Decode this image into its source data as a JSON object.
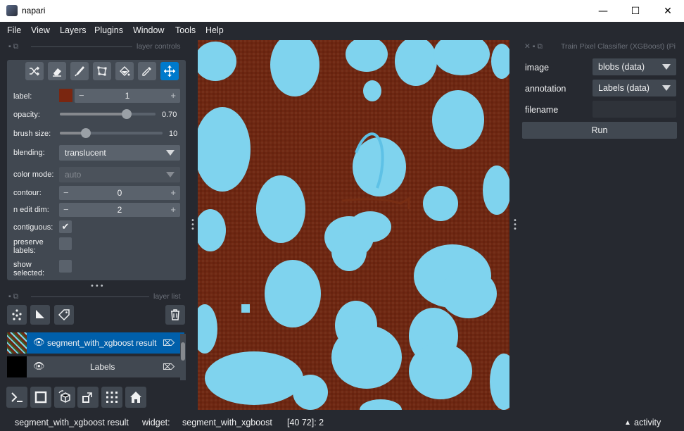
{
  "window": {
    "title": "napari",
    "minimize": "—",
    "maximize": "☐",
    "close": "✕"
  },
  "menu": [
    "File",
    "View",
    "Layers",
    "Plugins",
    "Window",
    "Tools",
    "Help"
  ],
  "layer_controls": {
    "header": "layer controls",
    "label_label": "label:",
    "label_value": "1",
    "label_color": "#7a2610",
    "opacity_label": "opacity:",
    "opacity_value": "0.70",
    "opacity_fraction": 0.7,
    "brush_label": "brush size:",
    "brush_value": "10",
    "brush_fraction": 0.25,
    "blending_label": "blending:",
    "blending_value": "translucent",
    "color_mode_label": "color mode:",
    "color_mode_value": "auto",
    "contour_label": "contour:",
    "contour_value": "0",
    "ndim_label": "n edit dim:",
    "ndim_value": "2",
    "contiguous_label": "contiguous:",
    "preserve_label_1": "preserve",
    "preserve_label_2": "labels:",
    "show_label_1": "show",
    "show_label_2": "selected:"
  },
  "layer_list": {
    "header": "layer list",
    "layers": [
      {
        "name": "segment_with_xgboost result",
        "selected": true
      },
      {
        "name": "Labels",
        "selected": false
      }
    ]
  },
  "widget": {
    "header": "Train Pixel Classifier (XGBoost) (Pi",
    "image_label": "image",
    "image_value": "blobs (data)",
    "annotation_label": "annotation",
    "annotation_value": "Labels (data)",
    "filename_label": "filename",
    "run_label": "Run"
  },
  "status": {
    "layer": "segment_with_xgboost result",
    "widget_label": "widget:",
    "widget_value": "segment_with_xgboost",
    "coords": "[40 72]: 2",
    "activity": "activity",
    "activity_icon": "▲"
  },
  "colors": {
    "accent": "#007acc",
    "background": "#262930",
    "panel": "#414851",
    "blob": "#7fd3ee",
    "canvas_bg": "#6e2712"
  }
}
